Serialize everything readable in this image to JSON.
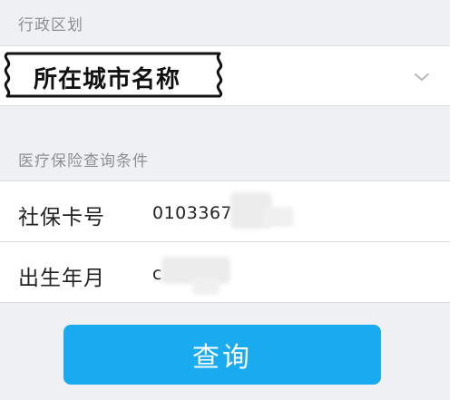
{
  "region_section": {
    "label": "行政区划",
    "selected_value": "所在城市名称"
  },
  "insurance_section": {
    "label": "医疗保险查询条件",
    "fields": [
      {
        "label": "社保卡号",
        "value": "0103367"
      },
      {
        "label": "出生年月",
        "value": "c"
      }
    ]
  },
  "query_button": {
    "label": "查询"
  },
  "colors": {
    "background": "#eff0f4",
    "button": "#19aaf0",
    "label_gray": "#8e8e93"
  },
  "icons": {
    "region_dropdown": "chevron-down-icon"
  }
}
